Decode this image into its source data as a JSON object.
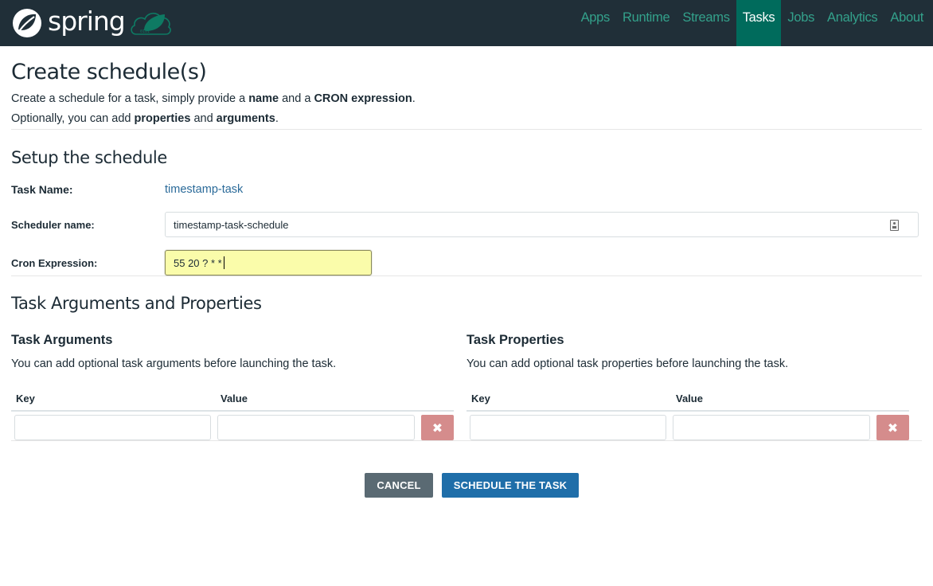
{
  "header": {
    "brand_name": "spring",
    "nav": [
      {
        "label": "Apps",
        "active": false
      },
      {
        "label": "Runtime",
        "active": false
      },
      {
        "label": "Streams",
        "active": false
      },
      {
        "label": "Tasks",
        "active": true
      },
      {
        "label": "Jobs",
        "active": false
      },
      {
        "label": "Analytics",
        "active": false
      },
      {
        "label": "About",
        "active": false
      }
    ]
  },
  "page": {
    "title": "Create schedule(s)",
    "intro_line1": {
      "pre": "Create a schedule for a task, simply provide a ",
      "bold1": "name",
      "mid": " and a ",
      "bold2": "CRON expression",
      "post": "."
    },
    "intro_line2": {
      "pre": "Optionally, you can add ",
      "bold1": "properties",
      "mid": " and ",
      "bold2": "arguments",
      "post": "."
    }
  },
  "setup": {
    "title": "Setup the schedule",
    "task_name_label": "Task Name:",
    "task_name_value": "timestamp-task",
    "scheduler_name_label": "Scheduler name:",
    "scheduler_name_value": "timestamp-task-schedule",
    "cron_label": "Cron Expression:",
    "cron_value": "55 20 ? * *"
  },
  "args_props": {
    "title": "Task Arguments and Properties",
    "arguments": {
      "title": "Task Arguments",
      "description": "You can add optional task arguments before launching the task.",
      "key_header": "Key",
      "value_header": "Value",
      "rows": [
        {
          "key": "",
          "value": ""
        }
      ],
      "remove_icon": "times-icon"
    },
    "properties": {
      "title": "Task Properties",
      "description": "You can add optional task properties before launching the task.",
      "key_header": "Key",
      "value_header": "Value",
      "rows": [
        {
          "key": "",
          "value": ""
        }
      ],
      "remove_icon": "times-icon"
    }
  },
  "actions": {
    "cancel_label": "CANCEL",
    "submit_label": "SCHEDULE THE TASK"
  },
  "colors": {
    "navbar_bg": "#202f38",
    "nav_link": "#33a18b",
    "nav_active_bg": "#006b5c",
    "link_text": "#2a6a99",
    "cron_input_bg": "#fafcaa",
    "remove_button": "#d58c8c",
    "cancel_button": "#5a6a73",
    "submit_button": "#1f6ea9"
  }
}
